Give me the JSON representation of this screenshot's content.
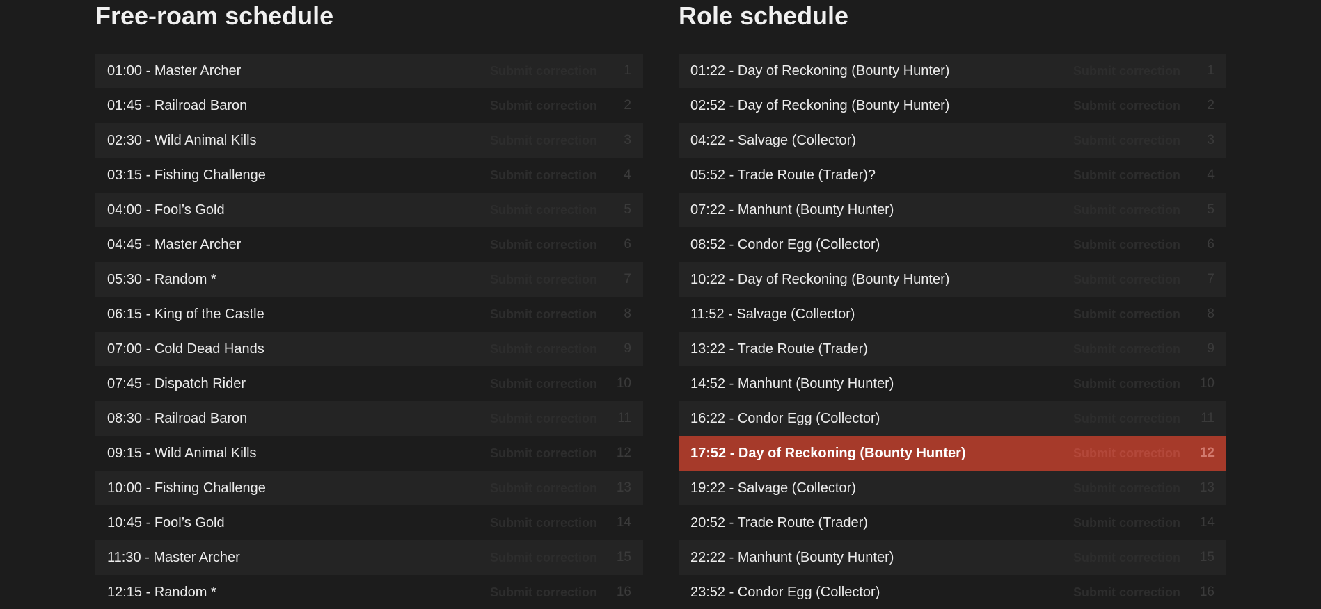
{
  "free_roam": {
    "title": "Free-roam schedule",
    "correction_label": "Submit correction",
    "items": [
      {
        "label": "01:00 - Master Archer",
        "num": "1"
      },
      {
        "label": "01:45 - Railroad Baron",
        "num": "2"
      },
      {
        "label": "02:30 - Wild Animal Kills",
        "num": "3"
      },
      {
        "label": "03:15 - Fishing Challenge",
        "num": "4"
      },
      {
        "label": "04:00 - Fool’s Gold",
        "num": "5"
      },
      {
        "label": "04:45 - Master Archer",
        "num": "6"
      },
      {
        "label": "05:30 - Random *",
        "num": "7"
      },
      {
        "label": "06:15 - King of the Castle",
        "num": "8"
      },
      {
        "label": "07:00 - Cold Dead Hands",
        "num": "9"
      },
      {
        "label": "07:45 - Dispatch Rider",
        "num": "10"
      },
      {
        "label": "08:30 - Railroad Baron",
        "num": "11"
      },
      {
        "label": "09:15 - Wild Animal Kills",
        "num": "12"
      },
      {
        "label": "10:00 - Fishing Challenge",
        "num": "13"
      },
      {
        "label": "10:45 - Fool’s Gold",
        "num": "14"
      },
      {
        "label": "11:30 - Master Archer",
        "num": "15"
      },
      {
        "label": "12:15 - Random *",
        "num": "16"
      }
    ]
  },
  "role": {
    "title": "Role schedule",
    "correction_label": "Submit correction",
    "active_index": 11,
    "highlight_color": "#a63a2a",
    "items": [
      {
        "label": "01:22 - Day of Reckoning (Bounty Hunter)",
        "num": "1"
      },
      {
        "label": "02:52 - Day of Reckoning (Bounty Hunter)",
        "num": "2"
      },
      {
        "label": "04:22 - Salvage (Collector)",
        "num": "3"
      },
      {
        "label": "05:52 - Trade Route (Trader)?",
        "num": "4"
      },
      {
        "label": "07:22 - Manhunt (Bounty Hunter)",
        "num": "5"
      },
      {
        "label": "08:52 - Condor Egg (Collector)",
        "num": "6"
      },
      {
        "label": "10:22 - Day of Reckoning (Bounty Hunter)",
        "num": "7"
      },
      {
        "label": "11:52 - Salvage (Collector)",
        "num": "8"
      },
      {
        "label": "13:22 - Trade Route (Trader)",
        "num": "9"
      },
      {
        "label": "14:52 - Manhunt (Bounty Hunter)",
        "num": "10"
      },
      {
        "label": "16:22 - Condor Egg (Collector)",
        "num": "11"
      },
      {
        "label": "17:52 - Day of Reckoning (Bounty Hunter)",
        "num": "12"
      },
      {
        "label": "19:22 - Salvage (Collector)",
        "num": "13"
      },
      {
        "label": "20:52 - Trade Route (Trader)",
        "num": "14"
      },
      {
        "label": "22:22 - Manhunt (Bounty Hunter)",
        "num": "15"
      },
      {
        "label": "23:52 - Condor Egg (Collector)",
        "num": "16"
      }
    ]
  }
}
